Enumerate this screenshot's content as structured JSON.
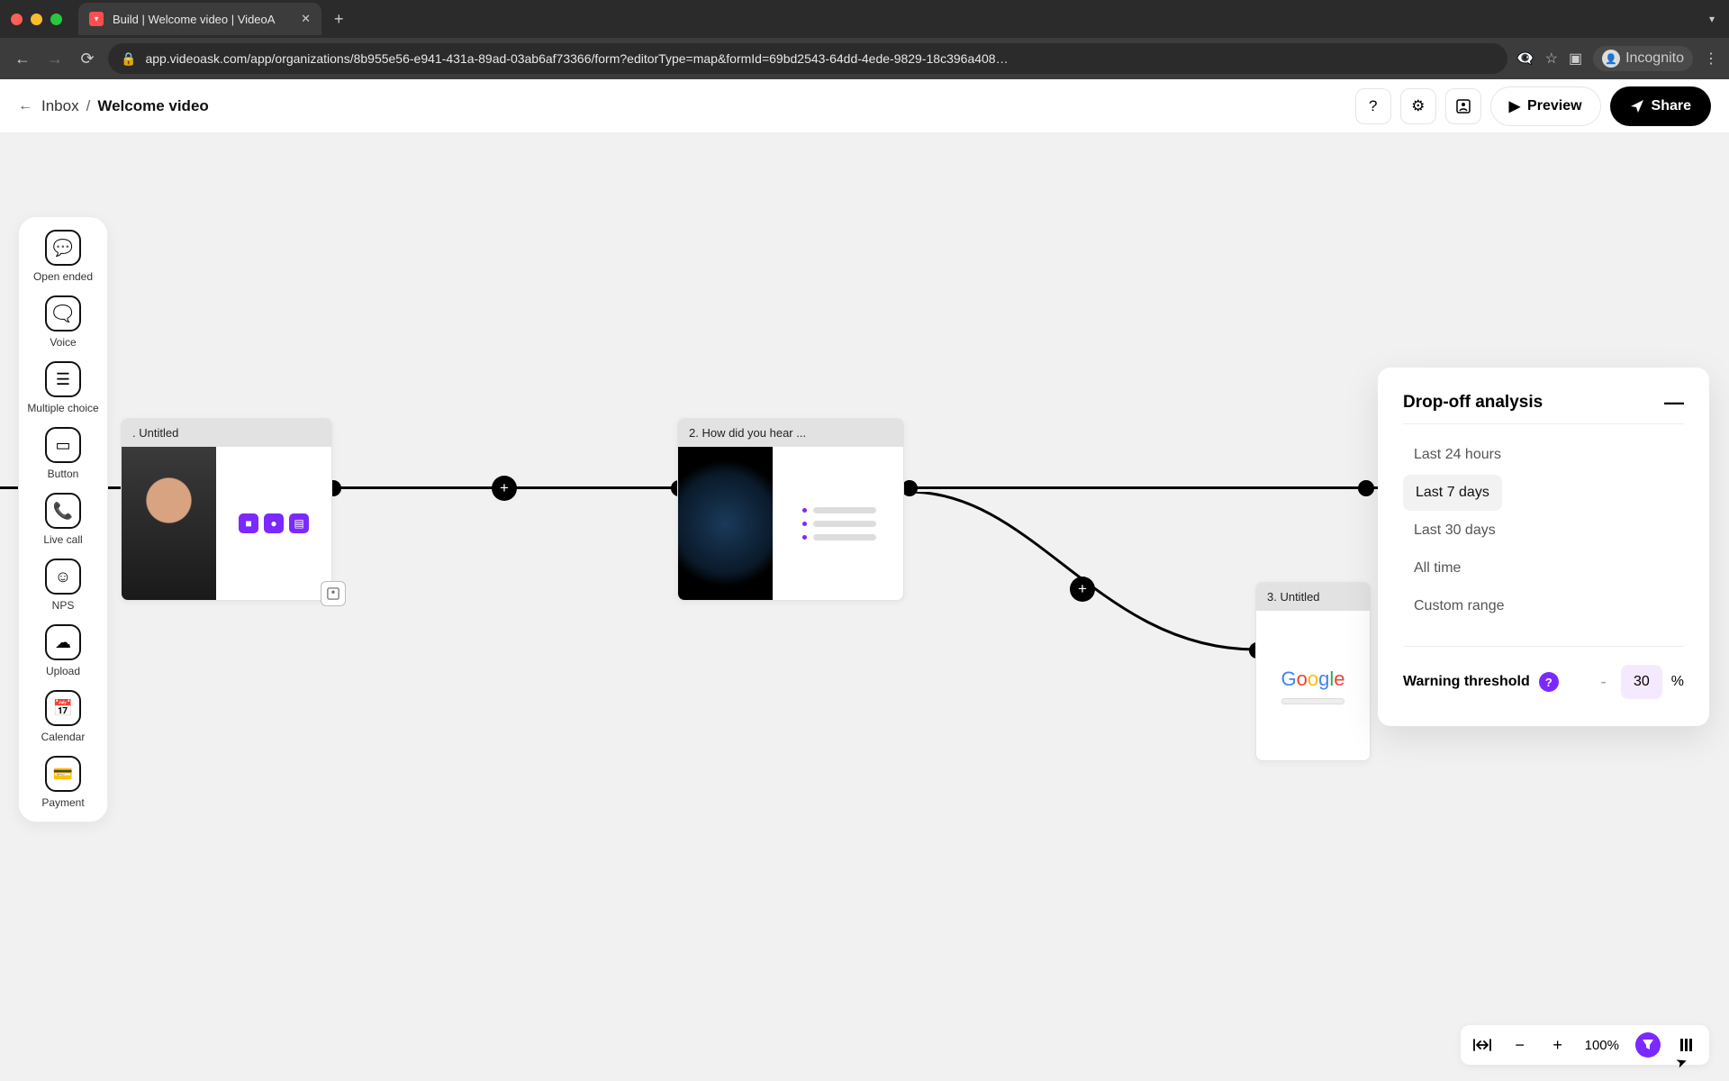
{
  "browser": {
    "tab_title": "Build | Welcome video | VideoA",
    "url": "app.videoask.com/app/organizations/8b955e56-e941-431a-89ad-03ab6af73366/form?editorType=map&formId=69bd2543-64dd-4ede-9829-18c396a408…",
    "incognito_label": "Incognito"
  },
  "header": {
    "inbox_label": "Inbox",
    "separator": "/",
    "current": "Welcome video",
    "preview_label": "Preview",
    "share_label": "Share"
  },
  "toolbox": {
    "items": [
      {
        "label": "Open ended",
        "icon": "chat-bubble"
      },
      {
        "label": "Voice",
        "icon": "voice-bubble"
      },
      {
        "label": "Multiple choice",
        "icon": "list"
      },
      {
        "label": "Button",
        "icon": "button"
      },
      {
        "label": "Live call",
        "icon": "phone"
      },
      {
        "label": "NPS",
        "icon": "smile"
      },
      {
        "label": "Upload",
        "icon": "cloud-up"
      },
      {
        "label": "Calendar",
        "icon": "calendar"
      },
      {
        "label": "Payment",
        "icon": "card"
      }
    ]
  },
  "cards": {
    "c1": {
      "title": ". Untitled"
    },
    "c2": {
      "title": "2. How did you hear ..."
    },
    "c3": {
      "title": "3. Untitled",
      "logo": "Google"
    }
  },
  "panel": {
    "title": "Drop-off analysis",
    "ranges": [
      "Last 24 hours",
      "Last 7 days",
      "Last 30 days",
      "All time",
      "Custom range"
    ],
    "active_index": 1,
    "threshold_label": "Warning threshold",
    "threshold_value": "30",
    "threshold_unit": "%"
  },
  "zoom": {
    "level": "100%"
  }
}
